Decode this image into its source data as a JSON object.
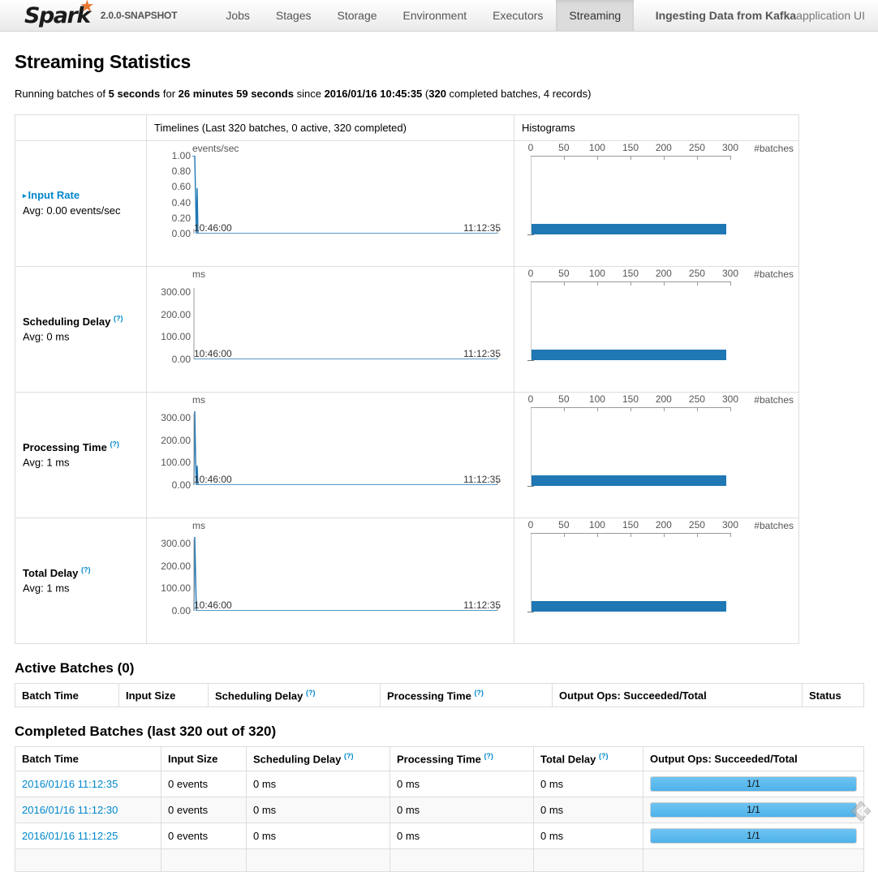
{
  "navbar": {
    "brand_text": "Spark",
    "brand_star": "★",
    "version": "2.0.0-SNAPSHOT",
    "items": [
      {
        "label": "Jobs",
        "active": false
      },
      {
        "label": "Stages",
        "active": false
      },
      {
        "label": "Storage",
        "active": false
      },
      {
        "label": "Environment",
        "active": false
      },
      {
        "label": "Executors",
        "active": false
      },
      {
        "label": "Streaming",
        "active": true
      }
    ],
    "app_name": "Ingesting Data from Kafka",
    "app_suffix": " application UI"
  },
  "page": {
    "title": "Streaming Statistics",
    "running_prefix": "Running batches of ",
    "batch_interval": "5 seconds",
    "running_mid1": " for ",
    "uptime": "26 minutes 59 seconds",
    "running_mid2": " since ",
    "start_time": "2016/01/16 10:45:35",
    "running_mid3": " (",
    "completed_count": "320",
    "running_mid4": " completed batches, 4 records)"
  },
  "stats_table": {
    "headers": {
      "blank": "",
      "timelines": "Timelines (Last 320 batches, 0 active, 320 completed)",
      "histograms": "Histograms"
    },
    "rows": [
      {
        "name": "Input Rate",
        "is_link": true,
        "has_help": false,
        "triangle": "▸",
        "avg": "Avg: 0.00 events/sec",
        "unit": "events/sec",
        "y_ticks": [
          "1.00",
          "0.80",
          "0.60",
          "0.40",
          "0.20",
          "0.00"
        ],
        "x_start": "10:46:00",
        "x_end": "11:12:35",
        "hist_unit": "#batches",
        "hist_ticks": [
          "0",
          "50",
          "100",
          "150",
          "200",
          "250",
          "300"
        ]
      },
      {
        "name": "Scheduling Delay",
        "is_link": false,
        "has_help": true,
        "help": "(?)",
        "avg": "Avg: 0 ms",
        "unit": "ms",
        "y_ticks": [
          "300.00",
          "200.00",
          "100.00",
          "0.00"
        ],
        "x_start": "10:46:00",
        "x_end": "11:12:35",
        "hist_unit": "#batches",
        "hist_ticks": [
          "0",
          "50",
          "100",
          "150",
          "200",
          "250",
          "300"
        ]
      },
      {
        "name": "Processing Time",
        "is_link": false,
        "has_help": true,
        "help": "(?)",
        "avg": "Avg: 1 ms",
        "unit": "ms",
        "y_ticks": [
          "300.00",
          "200.00",
          "100.00",
          "0.00"
        ],
        "x_start": "10:46:00",
        "x_end": "11:12:35",
        "hist_unit": "#batches",
        "hist_ticks": [
          "0",
          "50",
          "100",
          "150",
          "200",
          "250",
          "300"
        ]
      },
      {
        "name": "Total Delay",
        "is_link": false,
        "has_help": true,
        "help": "(?)",
        "avg": "Avg: 1 ms",
        "unit": "ms",
        "y_ticks": [
          "300.00",
          "200.00",
          "100.00",
          "0.00"
        ],
        "x_start": "10:46:00",
        "x_end": "11:12:35",
        "hist_unit": "#batches",
        "hist_ticks": [
          "0",
          "50",
          "100",
          "150",
          "200",
          "250",
          "300"
        ]
      }
    ]
  },
  "chart_data": [
    {
      "type": "line",
      "title": "Input Rate",
      "ylabel": "events/sec",
      "xlabel": "",
      "ylim": [
        0,
        1.0
      ],
      "y_ticks": [
        0.0,
        0.2,
        0.4,
        0.6,
        0.8,
        1.0
      ],
      "x_range": [
        "10:46:00",
        "11:12:35"
      ],
      "grid": false,
      "avg": 0.0,
      "series": [
        {
          "name": "input rate",
          "spike_value": 1.0,
          "baseline": 0.0,
          "spike_x_frac": 0.018
        }
      ],
      "histogram": {
        "type": "bar",
        "orientation": "horizontal",
        "xlabel": "#batches",
        "x_ticks": [
          0,
          50,
          100,
          150,
          200,
          250,
          300
        ],
        "bars": [
          {
            "bin": 0.0,
            "count": 320
          }
        ]
      }
    },
    {
      "type": "line",
      "title": "Scheduling Delay",
      "ylabel": "ms",
      "xlabel": "",
      "ylim": [
        0,
        350
      ],
      "y_ticks": [
        0,
        100,
        200,
        300
      ],
      "x_range": [
        "10:46:00",
        "11:12:35"
      ],
      "grid": false,
      "avg": 0,
      "series": [
        {
          "name": "scheduling delay",
          "spike_value": 0,
          "baseline": 0,
          "spike_x_frac": 0.018
        }
      ],
      "histogram": {
        "type": "bar",
        "orientation": "horizontal",
        "xlabel": "#batches",
        "x_ticks": [
          0,
          50,
          100,
          150,
          200,
          250,
          300
        ],
        "bars": [
          {
            "bin": 0,
            "count": 320
          }
        ]
      }
    },
    {
      "type": "line",
      "title": "Processing Time",
      "ylabel": "ms",
      "xlabel": "",
      "ylim": [
        0,
        350
      ],
      "y_ticks": [
        0,
        100,
        200,
        300
      ],
      "x_range": [
        "10:46:00",
        "11:12:35"
      ],
      "grid": false,
      "avg": 1,
      "series": [
        {
          "name": "processing time",
          "spike_value": 330,
          "baseline": 0,
          "spike_x_frac": 0.018
        }
      ],
      "histogram": {
        "type": "bar",
        "orientation": "horizontal",
        "xlabel": "#batches",
        "x_ticks": [
          0,
          50,
          100,
          150,
          200,
          250,
          300
        ],
        "bars": [
          {
            "bin": 0,
            "count": 320
          }
        ]
      }
    },
    {
      "type": "line",
      "title": "Total Delay",
      "ylabel": "ms",
      "xlabel": "",
      "ylim": [
        0,
        350
      ],
      "y_ticks": [
        0,
        100,
        200,
        300
      ],
      "x_range": [
        "10:46:00",
        "11:12:35"
      ],
      "grid": false,
      "avg": 1,
      "series": [
        {
          "name": "total delay",
          "spike_value": 330,
          "baseline": 0,
          "spike_x_frac": 0.018
        }
      ],
      "histogram": {
        "type": "bar",
        "orientation": "horizontal",
        "xlabel": "#batches",
        "x_ticks": [
          0,
          50,
          100,
          150,
          200,
          250,
          300
        ],
        "bars": [
          {
            "bin": 0,
            "count": 320
          }
        ]
      }
    }
  ],
  "active_batches": {
    "title": "Active Batches (0)",
    "columns": [
      "Batch Time",
      "Input Size",
      "Scheduling Delay",
      "Processing Time",
      "Output Ops: Succeeded/Total",
      "Status"
    ],
    "help": "(?)",
    "rows": []
  },
  "completed_batches": {
    "title": "Completed Batches (last 320 out of 320)",
    "columns": [
      "Batch Time",
      "Input Size",
      "Scheduling Delay",
      "Processing Time",
      "Total Delay",
      "Output Ops: Succeeded/Total"
    ],
    "help": "(?)",
    "rows": [
      {
        "batch_time": "2016/01/16 11:12:35",
        "input_size": "0 events",
        "scheduling_delay": "0 ms",
        "processing_time": "0 ms",
        "total_delay": "0 ms",
        "output_ops": "1/1",
        "progress_pct": 100
      },
      {
        "batch_time": "2016/01/16 11:12:30",
        "input_size": "0 events",
        "scheduling_delay": "0 ms",
        "processing_time": "0 ms",
        "total_delay": "0 ms",
        "output_ops": "1/1",
        "progress_pct": 100
      },
      {
        "batch_time": "2016/01/16 11:12:25",
        "input_size": "0 events",
        "scheduling_delay": "0 ms",
        "processing_time": "0 ms",
        "total_delay": "0 ms",
        "output_ops": "1/1",
        "progress_pct": 100
      }
    ]
  },
  "colors": {
    "accent_blue": "#0088cc",
    "chart_line": "#1f77b4",
    "histogram_bar": "#1f77b4",
    "progress_bar": "#4eb2ea",
    "brand_orange": "#e8762c",
    "active_tab": "#dcdcdc"
  }
}
